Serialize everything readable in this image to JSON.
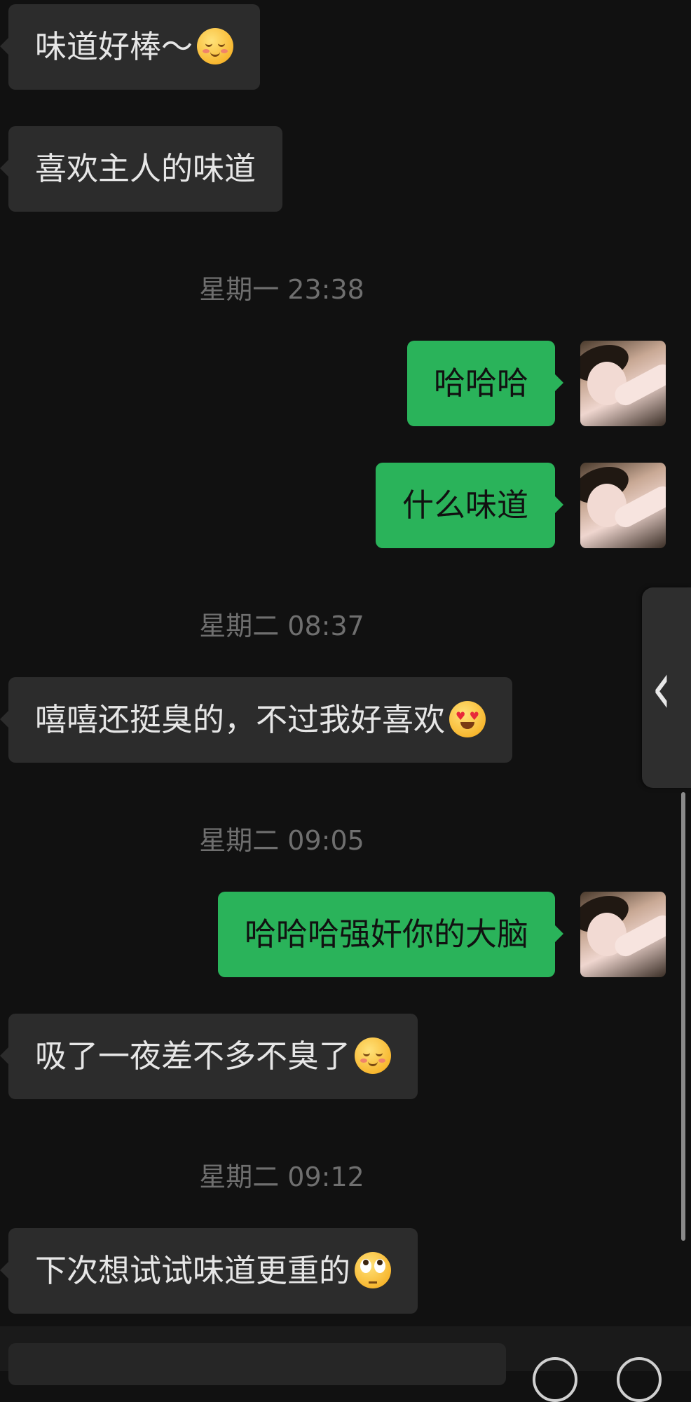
{
  "messages": [
    {
      "side": "in",
      "text": "味道好棒～",
      "emoji": "blushing-smile-emoji"
    },
    {
      "side": "in",
      "text": "喜欢主人的味道"
    },
    {
      "type": "timestamp",
      "text": "星期一 23:38"
    },
    {
      "side": "out",
      "text": "哈哈哈"
    },
    {
      "side": "out",
      "text": "什么味道"
    },
    {
      "type": "timestamp",
      "text": "星期二 08:37"
    },
    {
      "side": "in",
      "text": "嘻嘻还挺臭的，不过我好喜欢",
      "emoji": "heart-eyes-emoji"
    },
    {
      "type": "timestamp",
      "text": "星期二 09:05"
    },
    {
      "side": "out",
      "text": "哈哈哈强奸你的大脑"
    },
    {
      "side": "in",
      "text": "吸了一夜差不多不臭了",
      "emoji": "blushing-smile-emoji"
    },
    {
      "type": "timestamp",
      "text": "星期二 09:12"
    },
    {
      "side": "in",
      "text": "下次想试试味道更重的",
      "emoji": "rolling-eyes-emoji"
    }
  ],
  "colors": {
    "background": "#111111",
    "incoming_bubble": "#2c2c2c",
    "outgoing_bubble": "#2ab35a",
    "timestamp_text": "#6f6f6f"
  },
  "side_panel": {
    "icon": "chevron-left-icon"
  }
}
